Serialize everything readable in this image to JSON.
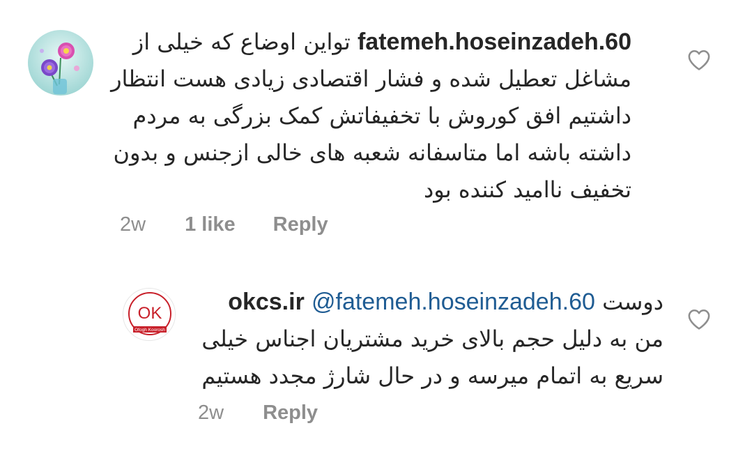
{
  "comments": [
    {
      "username": "fatemeh.hoseinzadeh.60",
      "text_line_1": "تواین اوضاع که خیلی از",
      "text_lines": [
        "مشاغل تعطیل شده و فشار اقتصادی زیادی هست  انتظار",
        "داشتیم افق کوروش با  تخفیفاتش کمک بزرگی به مردم",
        "داشته باشه اما متاسفانه شعبه های خالی ازجنس و بدون",
        "تخفیف ناامید کننده بود"
      ],
      "time": "2w",
      "likes": "1 like",
      "reply_label": "Reply",
      "avatar_icon": "flower-avatar-icon",
      "like_icon": "heart-outline-icon"
    },
    {
      "username": "okcs.ir",
      "mention": "@fatemeh.hoseinzadeh.60",
      "text_line_1_suffix": "دوست",
      "text_lines": [
        "من به دلیل حجم بالای خرید مشتریان اجناس خیلی",
        "سریع به اتمام میرسه و در حال شارژ مجدد هستیم"
      ],
      "time": "2w",
      "reply_label": "Reply",
      "avatar_icon": "ofogh-koorosh-logo-icon",
      "avatar_logo_text": "OK",
      "avatar_logo_subtext": "Ofogh Koorosh",
      "like_icon": "heart-outline-icon"
    }
  ],
  "colors": {
    "text": "#262626",
    "secondary": "#8e8e8e",
    "mention": "#1f5c93",
    "brand_red": "#c8202a"
  }
}
